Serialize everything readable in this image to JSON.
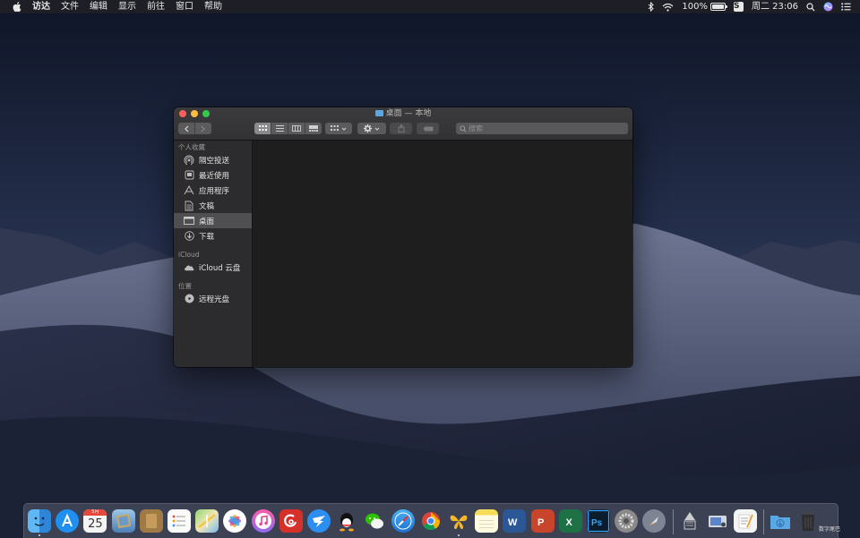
{
  "menubar": {
    "app_name": "访达",
    "menus": [
      "文件",
      "编辑",
      "显示",
      "前往",
      "窗口",
      "帮助"
    ],
    "battery_percent": "100%",
    "battery_level": 1.0,
    "input_method_label": "S",
    "clock": "周二 23:06"
  },
  "window": {
    "title": "桌面 — 本地",
    "search_placeholder": "搜索",
    "sidebar": {
      "favorites_header": "个人收藏",
      "favorites": [
        {
          "label": "隔空投送",
          "icon": "airdrop-icon"
        },
        {
          "label": "最近使用",
          "icon": "recents-icon"
        },
        {
          "label": "应用程序",
          "icon": "applications-icon"
        },
        {
          "label": "文稿",
          "icon": "documents-icon"
        },
        {
          "label": "桌面",
          "icon": "desktop-icon",
          "selected": true
        },
        {
          "label": "下载",
          "icon": "downloads-icon"
        }
      ],
      "icloud_header": "iCloud",
      "icloud": [
        {
          "label": "iCloud 云盘",
          "icon": "icloud-drive-icon"
        }
      ],
      "locations_header": "位置",
      "locations": [
        {
          "label": "远程光盘",
          "icon": "remote-disc-icon"
        }
      ]
    }
  },
  "dock": {
    "calendar_month": "5月",
    "calendar_day": "25",
    "apps": [
      "finder-icon",
      "app-store-icon",
      "calendar-icon",
      "preview-icon",
      "notefile-icon",
      "reminders-icon",
      "maps-icon",
      "photos-icon",
      "itunes-icon",
      "netease-music-icon",
      "dingtalk-icon",
      "qq-icon",
      "wechat-icon",
      "safari-icon",
      "chrome-icon",
      "butterfly-app-icon",
      "notes-icon",
      "word-icon",
      "powerpoint-icon",
      "excel-icon",
      "photoshop-icon",
      "system-preferences-icon",
      "launchpad-icon",
      "ftp-tool-icon",
      "image-capture-icon",
      "textedit-icon",
      "downloads-folder-icon",
      "trash-icon"
    ]
  },
  "watermark": "数字尾巴"
}
